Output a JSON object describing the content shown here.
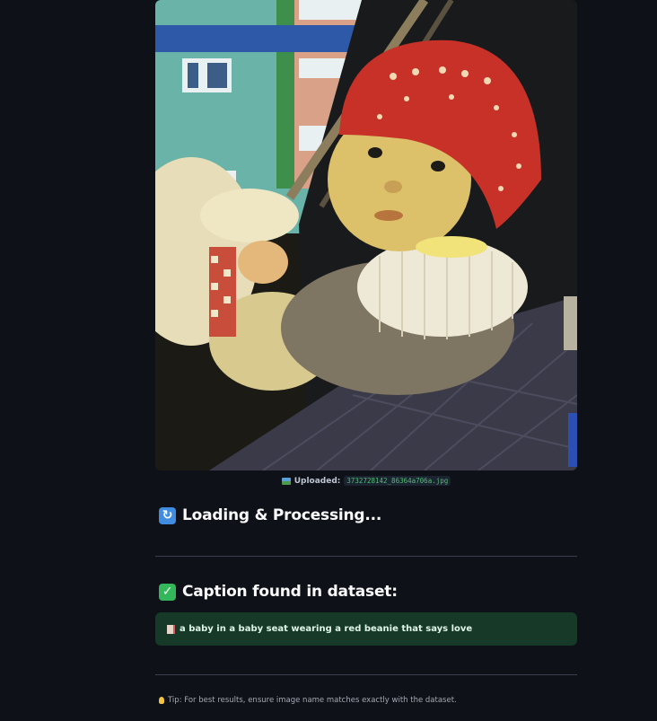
{
  "upload": {
    "label": "Uploaded:",
    "filename": "3732728142_86364a706a.jpg"
  },
  "sections": {
    "loading_title": "Loading & Processing...",
    "caption_title": "Caption found in dataset:"
  },
  "caption": {
    "text": "a baby in a baby seat wearing a red beanie that says love"
  },
  "tip": {
    "text": "Tip: For best results, ensure image name matches exactly with the dataset."
  },
  "icons": {
    "loading": "reload-icon",
    "found": "check-icon",
    "caption": "memo-icon",
    "tip": "lightbulb-icon",
    "upload": "image-icon"
  },
  "colors": {
    "background": "#0e1117",
    "success_bg": "#173928",
    "accent_blue": "#3f8ce0",
    "accent_green": "#34b65b"
  }
}
